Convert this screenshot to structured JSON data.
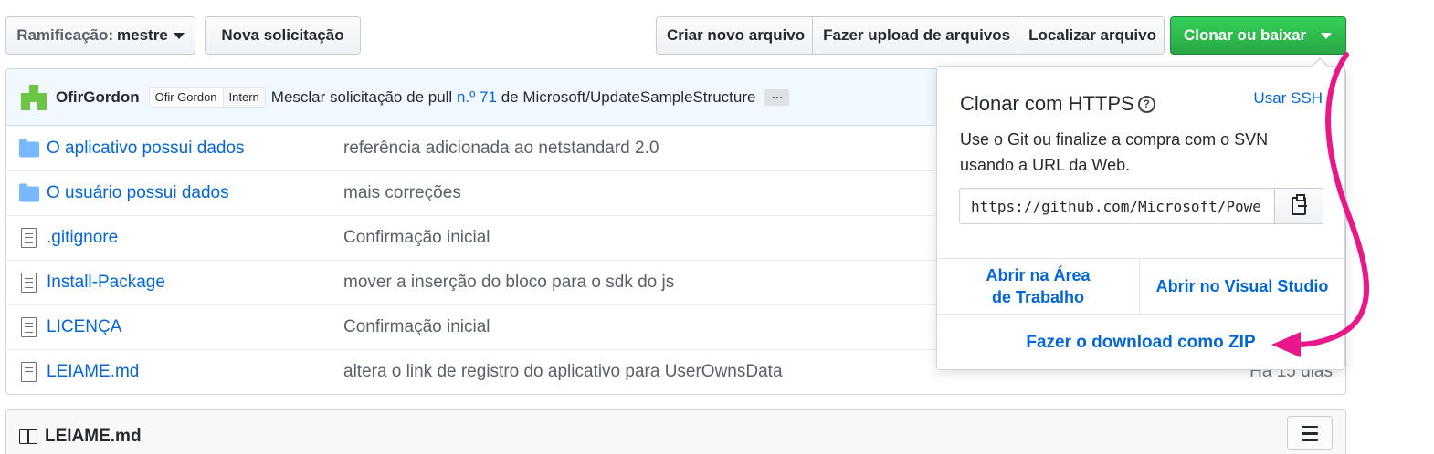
{
  "toolbar": {
    "branch_label": "Ramificação:",
    "branch_value": "mestre",
    "new_pr": "Nova solicitação",
    "create_file": "Criar novo arquivo",
    "upload_files": "Fazer upload de arquivos",
    "find_file": "Localizar arquivo",
    "clone_download": "Clonar ou baixar"
  },
  "commit": {
    "author": "OfirGordon",
    "tag_name": "Ofir Gordon",
    "tag_role": "Intern",
    "message_pre": "Mesclar solicitação de pull",
    "pr_link": "n.º 71",
    "message_post": "de Microsoft/UpdateSampleStructure",
    "ellipsis": "…"
  },
  "files": [
    {
      "type": "folder",
      "name": "O aplicativo possui dados",
      "message": "referência adicionada ao netstandard 2.0",
      "age": ""
    },
    {
      "type": "folder",
      "name": "O usuário possui dados",
      "message": "mais correções",
      "age": ""
    },
    {
      "type": "file",
      "name": ".gitignore",
      "message": "Confirmação inicial",
      "age": ""
    },
    {
      "type": "file",
      "name": "Install-Package",
      "message": "mover a inserção do bloco para o sdk do js",
      "age": ""
    },
    {
      "type": "file",
      "name": "LICENÇA",
      "message": "Confirmação inicial",
      "age": ""
    },
    {
      "type": "file",
      "name": "LEIAME.md",
      "message": "altera o link de registro do aplicativo para UserOwnsData",
      "age": "Há 15 dias"
    }
  ],
  "readme": {
    "title": "LEIAME.md"
  },
  "clone_popover": {
    "title": "Clonar com HTTPS",
    "help_icon": "?",
    "use_ssh": "Usar SSH",
    "description": "Use o Git ou finalize a compra com o SVN usando a URL da Web.",
    "url": "https://github.com/Microsoft/PowerBI-Developer-Samples.git",
    "open_desktop_line1": "Abrir na Área",
    "open_desktop_line2": "de Trabalho",
    "open_vs": "Abrir no Visual Studio",
    "download_zip": "Fazer o download como ZIP"
  },
  "colors": {
    "accent_green": "#28a745",
    "link_blue": "#0366d6",
    "annotation_arrow": "#e8178a"
  }
}
